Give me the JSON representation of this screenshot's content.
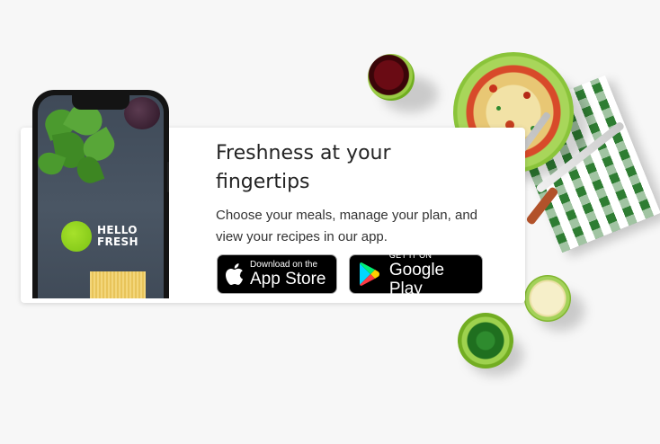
{
  "promo": {
    "title": "Freshness at your fingertips",
    "description": "Choose your meals, manage your plan, and view your recipes in our app."
  },
  "phone": {
    "brand_line1": "HELLO",
    "brand_line2": "FRESH"
  },
  "badges": {
    "apple": {
      "small": "Download on the",
      "big": "App Store",
      "icon": "apple-icon"
    },
    "google": {
      "small": "GET IT ON",
      "big": "Google Play",
      "icon": "google-play-icon"
    }
  },
  "colors": {
    "background": "#f7f7f7",
    "card": "#ffffff",
    "brand_green": "#7cc314",
    "badge_black": "#000000"
  }
}
